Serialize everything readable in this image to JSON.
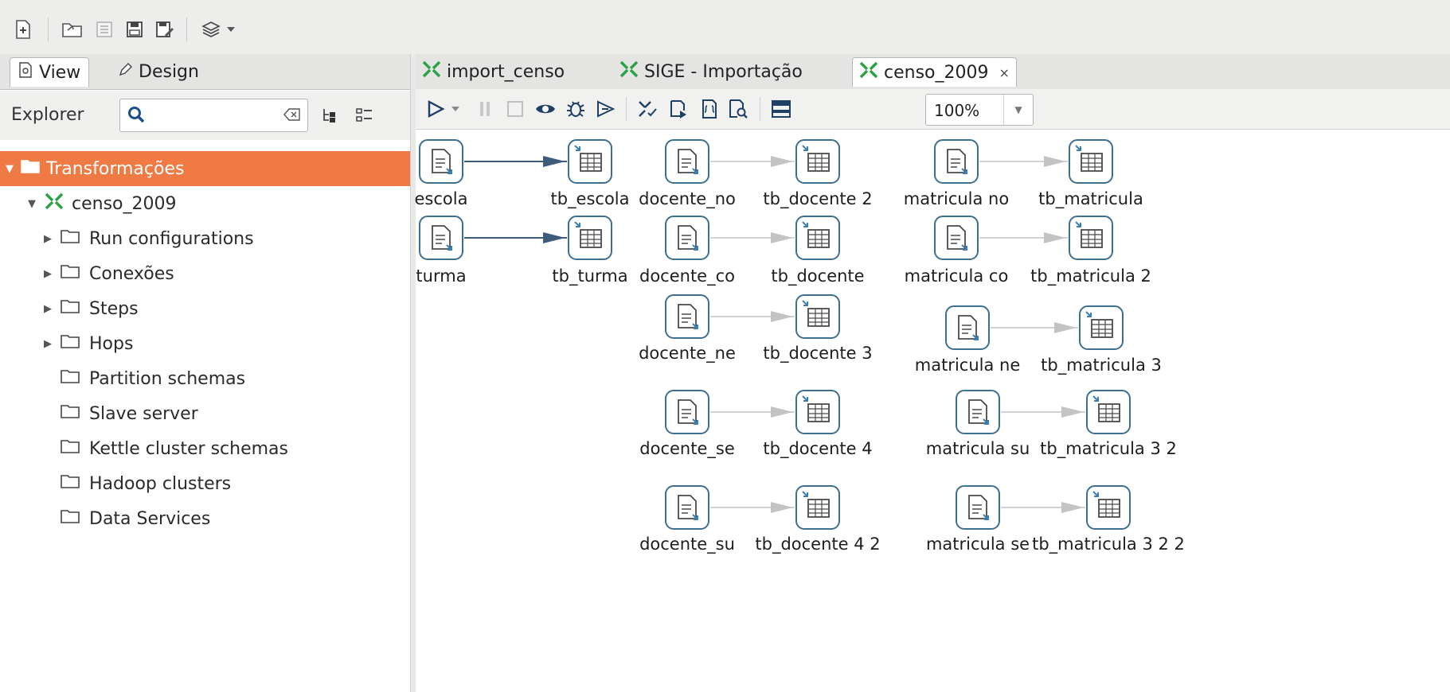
{
  "left_panel": {
    "tabs": [
      {
        "label": "View"
      },
      {
        "label": "Design"
      }
    ],
    "explorer_label": "Explorer",
    "search": {
      "value": "",
      "placeholder": ""
    },
    "tree": [
      {
        "label": "Transformações",
        "selected": true
      },
      {
        "label": "censo_2009"
      },
      {
        "label": "Run configurations"
      },
      {
        "label": "Conexões"
      },
      {
        "label": "Steps"
      },
      {
        "label": "Hops"
      },
      {
        "label": "Partition schemas"
      },
      {
        "label": "Slave server"
      },
      {
        "label": "Kettle cluster schemas"
      },
      {
        "label": "Hadoop clusters"
      },
      {
        "label": "Data Services"
      }
    ]
  },
  "editor": {
    "tabs": [
      {
        "label": "import_censo"
      },
      {
        "label": "SIGE - Importação"
      },
      {
        "label": "censo_2009",
        "active": true
      }
    ],
    "zoom": "100%"
  },
  "canvas": {
    "steps": [
      {
        "label": "escola",
        "kind": "input"
      },
      {
        "label": "tb_escola",
        "kind": "output"
      },
      {
        "label": "turma",
        "kind": "input"
      },
      {
        "label": "tb_turma",
        "kind": "output"
      },
      {
        "label": "docente_no",
        "kind": "input"
      },
      {
        "label": "tb_docente 2",
        "kind": "output"
      },
      {
        "label": "docente_co",
        "kind": "input"
      },
      {
        "label": "tb_docente",
        "kind": "output"
      },
      {
        "label": "docente_ne",
        "kind": "input"
      },
      {
        "label": "tb_docente 3",
        "kind": "output"
      },
      {
        "label": "docente_se",
        "kind": "input"
      },
      {
        "label": "tb_docente 4",
        "kind": "output"
      },
      {
        "label": "docente_su",
        "kind": "input"
      },
      {
        "label": "tb_docente 4 2",
        "kind": "output"
      },
      {
        "label": "matricula no",
        "kind": "input"
      },
      {
        "label": "tb_matricula",
        "kind": "output"
      },
      {
        "label": "matricula co",
        "kind": "input"
      },
      {
        "label": "tb_matricula 2",
        "kind": "output"
      },
      {
        "label": "matricula ne",
        "kind": "input"
      },
      {
        "label": "tb_matricula 3",
        "kind": "output"
      },
      {
        "label": "matricula su",
        "kind": "input"
      },
      {
        "label": "tb_matricula 3 2",
        "kind": "output"
      },
      {
        "label": "matricula se",
        "kind": "input"
      },
      {
        "label": "tb_matricula 3 2 2",
        "kind": "output"
      }
    ],
    "hops": [
      {
        "from": "escola",
        "to": "tb_escola",
        "enabled": true
      },
      {
        "from": "turma",
        "to": "tb_turma",
        "enabled": true
      },
      {
        "from": "docente_no",
        "to": "tb_docente 2",
        "enabled": false
      },
      {
        "from": "docente_co",
        "to": "tb_docente",
        "enabled": false
      },
      {
        "from": "docente_ne",
        "to": "tb_docente 3",
        "enabled": false
      },
      {
        "from": "docente_se",
        "to": "tb_docente 4",
        "enabled": false
      },
      {
        "from": "docente_su",
        "to": "tb_docente 4 2",
        "enabled": false
      },
      {
        "from": "matricula no",
        "to": "tb_matricula",
        "enabled": false
      },
      {
        "from": "matricula co",
        "to": "tb_matricula 2",
        "enabled": false
      },
      {
        "from": "matricula ne",
        "to": "tb_matricula 3",
        "enabled": false
      },
      {
        "from": "matricula su",
        "to": "tb_matricula 3 2",
        "enabled": false
      },
      {
        "from": "matricula se",
        "to": "tb_matricula 3 2 2",
        "enabled": false
      }
    ]
  },
  "colors": {
    "selected_row": "#ef7a43",
    "hop_enabled": "#3f5b7a",
    "hop_disabled": "#c3c3c3",
    "step_border": "#3f6f8f",
    "transformation_icon": "#2aa344"
  },
  "icons": {
    "toolbar": [
      "new-file-icon",
      "open-file-icon",
      "explore-repository-icon",
      "save-icon",
      "save-as-icon",
      "layers-icon",
      "chevron-down-icon"
    ],
    "editor_toolbar": [
      "run-icon",
      "chevron-down-icon",
      "pause-icon",
      "stop-icon",
      "preview-icon",
      "debug-icon",
      "replay-icon",
      "verify-icon",
      "impact-icon",
      "sql-icon",
      "explore-db-icon",
      "show-results-icon"
    ]
  }
}
